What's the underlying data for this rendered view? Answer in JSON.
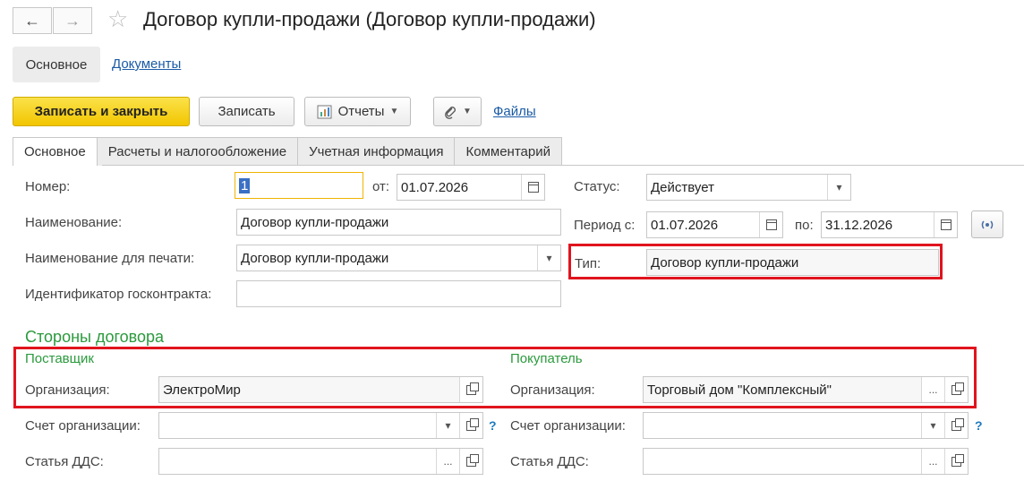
{
  "window": {
    "title": "Договор купли-продажи (Договор купли-продажи)"
  },
  "nav": {
    "back": "←",
    "forward": "→",
    "star": "☆"
  },
  "top_sections": {
    "main": "Основное",
    "documents": "Документы"
  },
  "toolbar": {
    "save_close": "Записать и закрыть",
    "save": "Записать",
    "reports": "Отчеты",
    "files": "Файлы"
  },
  "tabs": [
    {
      "label": "Основное"
    },
    {
      "label": "Расчеты и налогообложение"
    },
    {
      "label": "Учетная информация"
    },
    {
      "label": "Комментарий"
    }
  ],
  "form": {
    "number_label": "Номер:",
    "number_value": "1",
    "from_label": "от:",
    "from_value": "01.07.2026",
    "status_label": "Статус:",
    "status_value": "Действует",
    "name_label": "Наименование:",
    "name_value": "Договор купли-продажи",
    "period_label": "Период с:",
    "period_from": "01.07.2026",
    "period_to_label": "по:",
    "period_to": "31.12.2026",
    "print_name_label": "Наименование для печати:",
    "print_name_value": "Договор купли-продажи",
    "type_label": "Тип:",
    "type_value": "Договор купли-продажи",
    "gov_id_label": "Идентификатор госконтракта:",
    "gov_id_value": ""
  },
  "parties": {
    "title": "Стороны договора",
    "supplier": {
      "title": "Поставщик",
      "org_label": "Организация:",
      "org_value": "ЭлектроМир",
      "account_label": "Счет организации:",
      "account_value": "",
      "dds_label": "Статья ДДС:",
      "dds_value": ""
    },
    "buyer": {
      "title": "Покупатель",
      "org_label": "Организация:",
      "org_value": "Торговый дом \"Комплексный\"",
      "account_label": "Счет организации:",
      "account_value": "",
      "dds_label": "Статья ДДС:",
      "dds_value": ""
    }
  },
  "icons": {
    "help": "?",
    "dots": "...",
    "dropdown": "▾"
  }
}
